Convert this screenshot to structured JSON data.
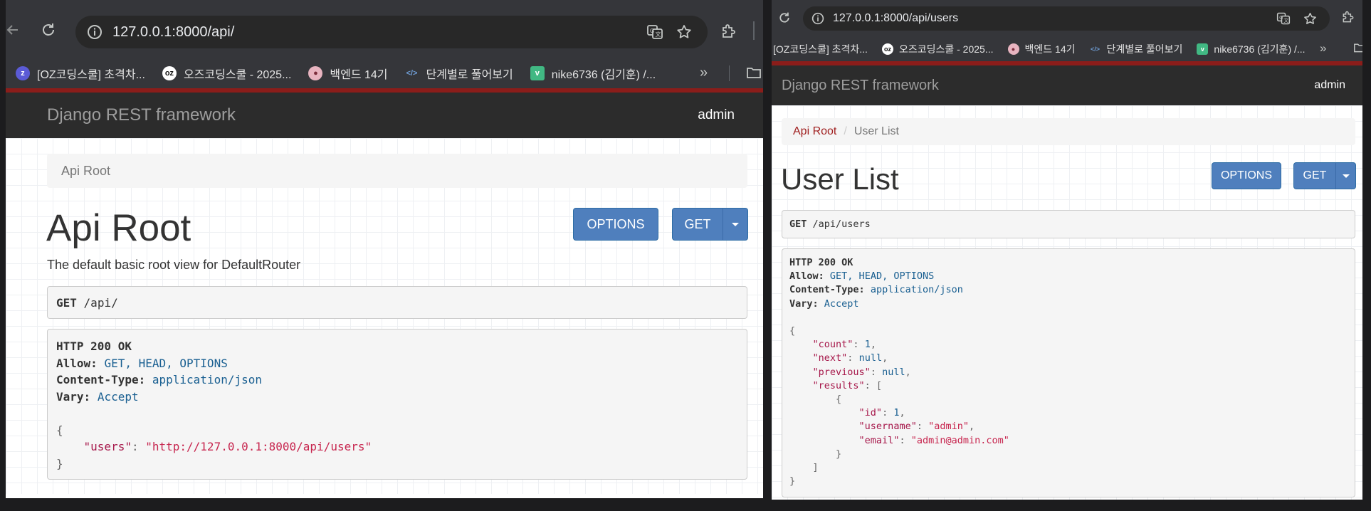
{
  "left_window": {
    "url": "127.0.0.1:8000/api/",
    "bookmarks": [
      {
        "label": "[OZ코딩스쿨] 초격차...",
        "favicon": "z",
        "color": "#5b5bd6"
      },
      {
        "label": "오즈코딩스쿨 - 2025...",
        "favicon": "oz",
        "color": "#111111"
      },
      {
        "label": "백엔드 14기",
        "favicon": "bear-icon",
        "color": "#e8b4c0"
      },
      {
        "label": "단계별로 풀어보기",
        "favicon": "code-icon",
        "color": "#6f9ed6"
      },
      {
        "label": "nike6736 (김기훈) /...",
        "favicon": "v",
        "color": "#41b883"
      }
    ],
    "navbar": {
      "brand": "Django REST framework",
      "user": "admin"
    },
    "breadcrumb": [
      "Api Root"
    ],
    "title": "Api Root",
    "description": "The default basic root view for DefaultRouter",
    "buttons": {
      "options": "OPTIONS",
      "get": "GET"
    },
    "request": {
      "method": "GET",
      "path": "/api/"
    },
    "response": {
      "status": "HTTP 200 OK",
      "headers": [
        {
          "name": "Allow:",
          "value": "GET, HEAD, OPTIONS"
        },
        {
          "name": "Content-Type:",
          "value": "application/json"
        },
        {
          "name": "Vary:",
          "value": "Accept"
        }
      ],
      "body": {
        "open": "{",
        "users_key": "\"users\"",
        "users_value": "\"http://127.0.0.1:8000/api/users\"",
        "close": "}"
      }
    }
  },
  "right_window": {
    "url": "127.0.0.1:8000/api/users",
    "bookmarks": [
      {
        "label": "[OZ코딩스쿨] 초격차...",
        "favicon": "none",
        "color": ""
      },
      {
        "label": "오즈코딩스쿨 - 2025...",
        "favicon": "oz",
        "color": "#111111"
      },
      {
        "label": "백엔드 14기",
        "favicon": "bear-icon",
        "color": "#e8b4c0"
      },
      {
        "label": "단계별로 풀어보기",
        "favicon": "code-icon",
        "color": "#6f9ed6"
      },
      {
        "label": "nike6736 (김기훈) /...",
        "favicon": "v",
        "color": "#41b883"
      }
    ],
    "navbar": {
      "brand": "Django REST framework",
      "user": "admin"
    },
    "breadcrumb": [
      "Api Root",
      "User List"
    ],
    "title": "User List",
    "buttons": {
      "options": "OPTIONS",
      "get": "GET"
    },
    "request": {
      "method": "GET",
      "path": "/api/users"
    },
    "response": {
      "status": "HTTP 200 OK",
      "headers": [
        {
          "name": "Allow:",
          "value": "GET, HEAD, OPTIONS"
        },
        {
          "name": "Content-Type:",
          "value": "application/json"
        },
        {
          "name": "Vary:",
          "value": "Accept"
        }
      ],
      "body": {
        "count_key": "\"count\"",
        "count_value": "1",
        "next_key": "\"next\"",
        "next_value": "null",
        "previous_key": "\"previous\"",
        "previous_value": "null",
        "results_key": "\"results\"",
        "id_key": "\"id\"",
        "id_value": "1",
        "username_key": "\"username\"",
        "username_value": "\"admin\"",
        "email_key": "\"email\"",
        "email_value": "\"admin@admin.com\""
      }
    }
  },
  "colors": {
    "navbar": "#2c2c2c",
    "brand_text": "#9d9d9d",
    "accent_red": "#8b1d1a",
    "button": "#4f7fbd",
    "json_key": "#a6174a",
    "json_string": "#c7254e",
    "json_literal": "#195f91"
  }
}
